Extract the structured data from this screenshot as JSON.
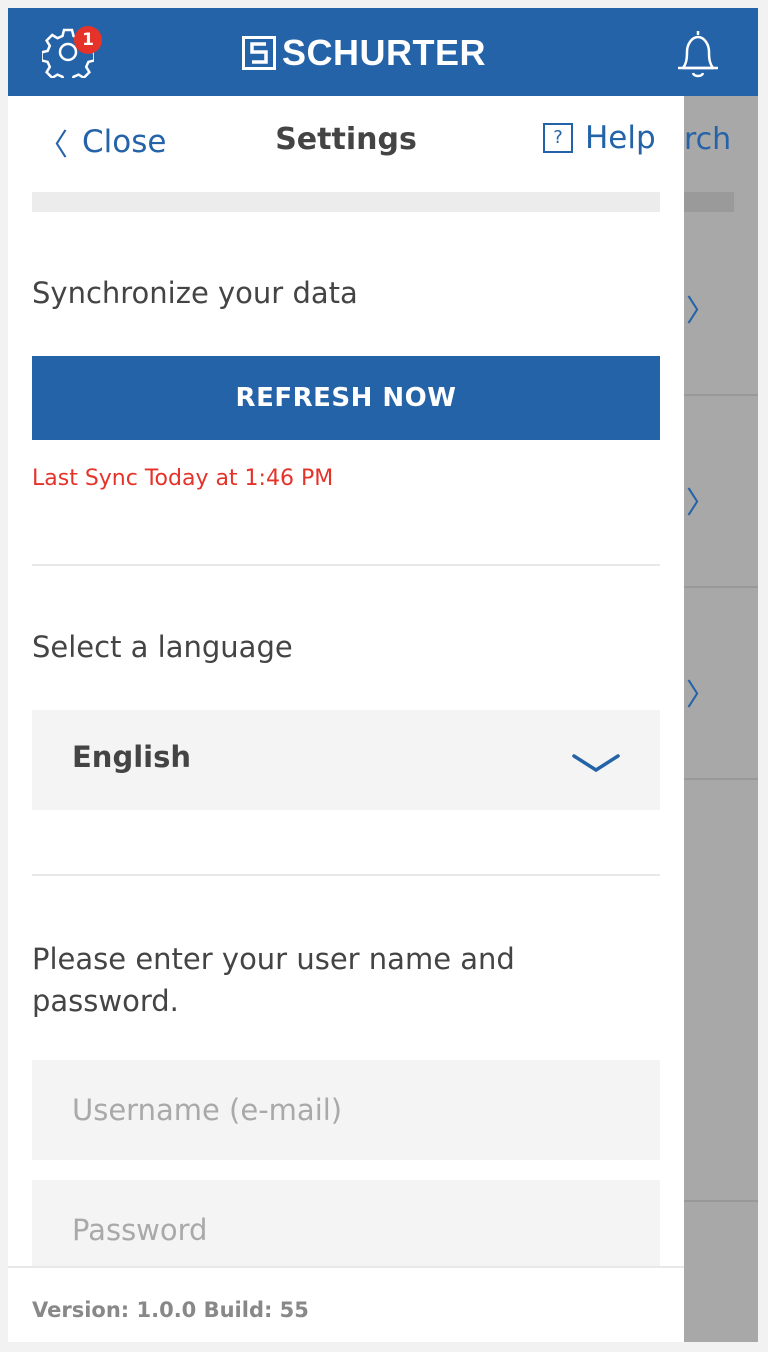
{
  "header": {
    "brand": "SCHURTER",
    "settings_badge_count": "1",
    "brand_color": "#2563a9",
    "badge_color": "#e5332a"
  },
  "background": {
    "visible_text": "rch"
  },
  "nav": {
    "close_label": "Close",
    "title": "Settings",
    "help_label": "Help",
    "help_icon_glyph": "?"
  },
  "sync": {
    "label": "Synchronize your data",
    "button_label": "REFRESH NOW",
    "status": "Last Sync Today at 1:46 PM",
    "status_color": "#e5332a"
  },
  "language": {
    "label": "Select a language",
    "selected": "English"
  },
  "login": {
    "intro": "Please enter your user name and password.",
    "username_placeholder": "Username (e-mail)",
    "password_placeholder": "Password"
  },
  "footer": {
    "version": "Version: 1.0.0 Build: 55"
  }
}
